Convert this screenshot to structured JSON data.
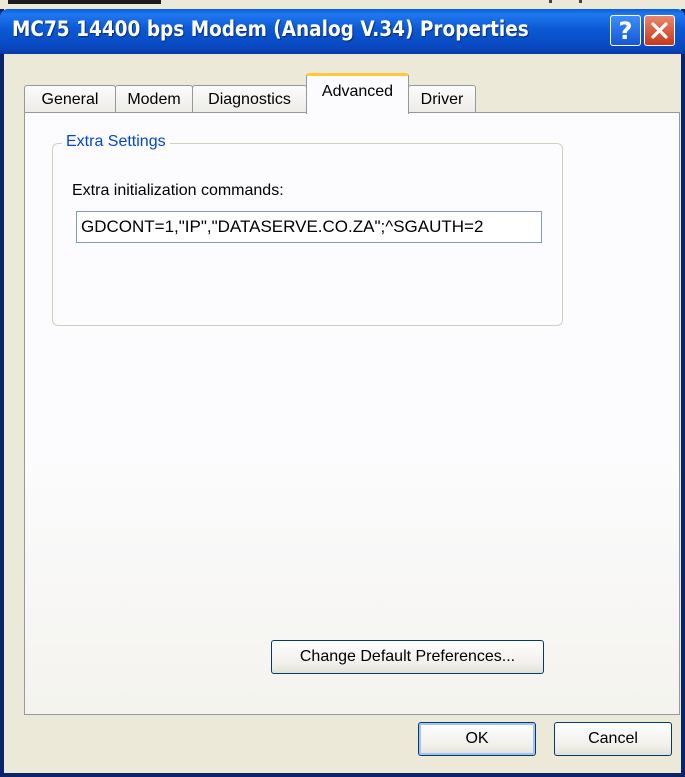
{
  "window": {
    "title": "MC75 14400 bps Modem (Analog V.34) Properties",
    "help_button": "?",
    "close_button": "×"
  },
  "tabs": [
    {
      "label": "General"
    },
    {
      "label": "Modem"
    },
    {
      "label": "Diagnostics"
    },
    {
      "label": "Advanced",
      "active": true
    },
    {
      "label": "Driver"
    }
  ],
  "extra_settings": {
    "group_title": "Extra Settings",
    "init_label": "Extra initialization commands:",
    "init_value": "GDCONT=1,\"IP\",\"DATASERVE.CO.ZA\";^SGAUTH=2"
  },
  "buttons": {
    "change_defaults": "Change Default Preferences...",
    "ok": "OK",
    "cancel": "Cancel"
  },
  "colors": {
    "titlebar": "#0b59d4",
    "active_tab_accent": "#ffc83c",
    "group_title": "#0046d5"
  }
}
